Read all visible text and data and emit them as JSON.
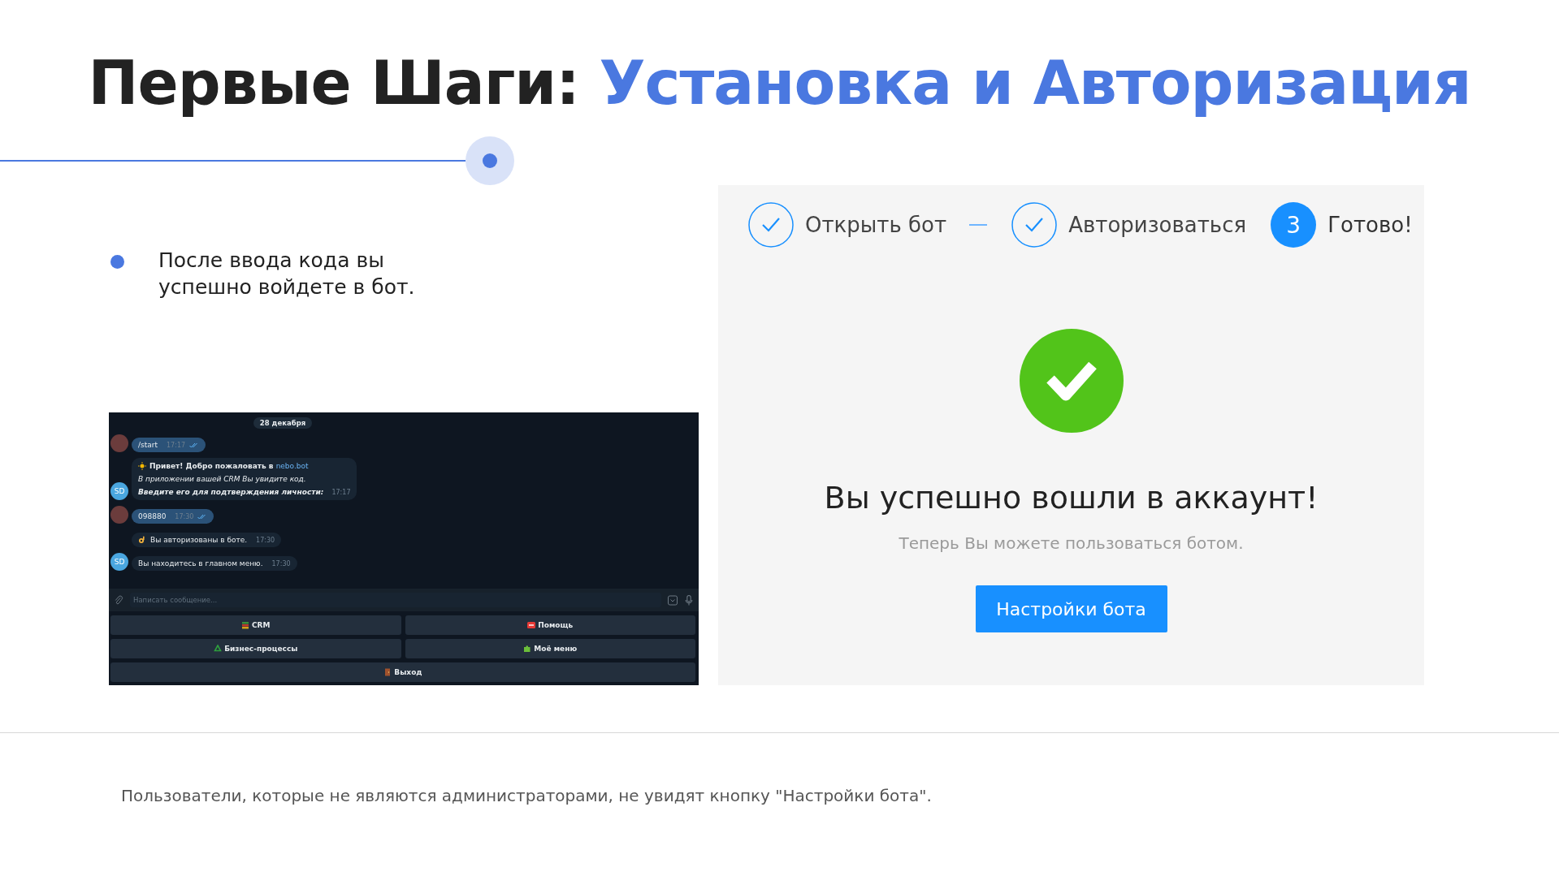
{
  "title": {
    "dark": "Первые Шаги:",
    "accent": "Установка и Авторизация"
  },
  "bullets": [
    "После ввода кода вы успешно войдете в бот."
  ],
  "chat": {
    "date": "28 декабря",
    "messages": [
      {
        "kind": "outgoing",
        "avatar_photo": true,
        "text": "/start",
        "time": "17:17",
        "read": true
      },
      {
        "kind": "welcome",
        "avatar": "SD",
        "greeting": "Привет! Добро пожаловать в",
        "link": "nebo.bot",
        "note": "В приложении вашей CRM Вы увидите код.",
        "prompt": "Введите его для подтверждения личности:",
        "time": "17:17"
      },
      {
        "kind": "outgoing",
        "avatar_photo": true,
        "text": "098880",
        "time": "17:30",
        "read": true
      },
      {
        "kind": "incoming",
        "text": "Вы авторизованы в боте.",
        "time": "17:30"
      },
      {
        "kind": "incoming",
        "avatar": "SD",
        "text": "Вы находитесь в главном меню.",
        "time": "17:30"
      }
    ],
    "input": {
      "placeholder": "Написать сообщение..."
    },
    "keyboard": [
      [
        {
          "label": "CRM"
        },
        {
          "label": "Помощь"
        }
      ],
      [
        {
          "label": "Бизнес-процессы"
        },
        {
          "label": "Моё меню"
        }
      ],
      [
        {
          "label": "Выход"
        }
      ]
    ]
  },
  "steps": [
    {
      "label": "Открыть бот",
      "done": true,
      "connector": true
    },
    {
      "label": "Авторизоваться",
      "done": true,
      "connector": false
    },
    {
      "label": "Готово!",
      "done": false,
      "number": "3",
      "connector": false
    }
  ],
  "result": {
    "heading": "Вы успешно вошли в аккаунт!",
    "subtitle": "Теперь Вы можете пользоваться ботом.",
    "button": "Настройки бота"
  },
  "footnote": "Пользователи, которые не являются администраторами, не увидят кнопку \"Настройки бота\"."
}
